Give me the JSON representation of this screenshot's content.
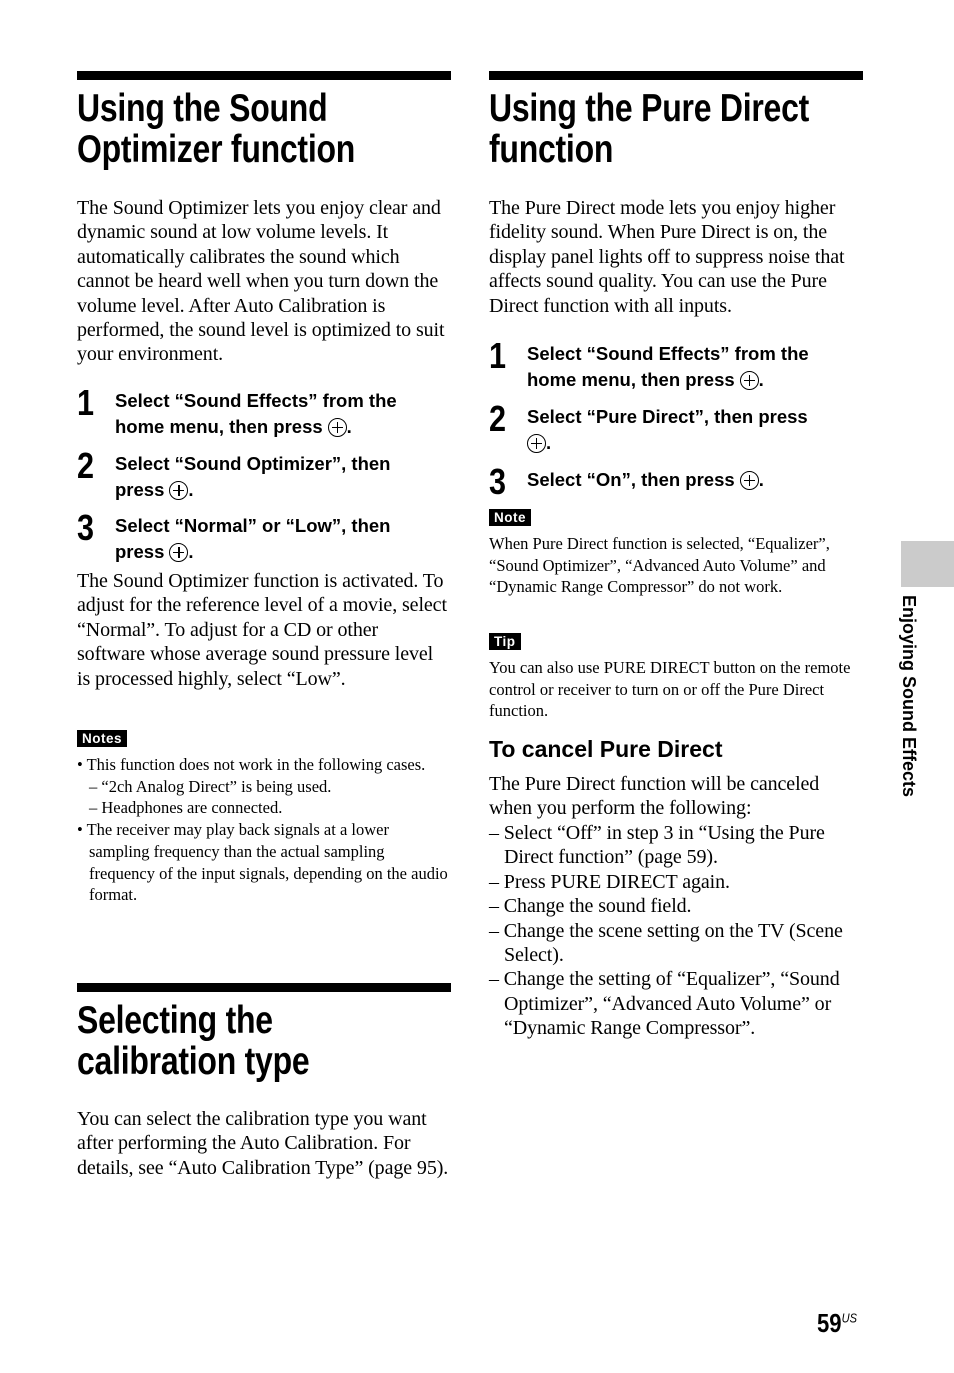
{
  "left": {
    "sound_optimizer": {
      "title_lines": [
        "Using the Sound",
        "Optimizer function"
      ],
      "intro": "The Sound Optimizer lets you enjoy clear and dynamic sound at low volume levels. It automatically calibrates the sound which cannot be heard well when you turn down the volume level. After Auto Calibration is performed, the sound level is optimized to suit your environment.",
      "steps": [
        {
          "num": "1",
          "lines": [
            "Select “Sound Effects” from the",
            "home menu, then press"
          ],
          "end": "."
        },
        {
          "num": "2",
          "lines": [
            "Select “Sound Optimizer”, then",
            "press"
          ],
          "end": "."
        },
        {
          "num": "3",
          "lines": [
            "Select “Normal” or “Low”, then",
            "press"
          ],
          "end": "."
        }
      ],
      "result": "The Sound Optimizer function is activated. To adjust for the reference level of a movie, select “Normal”. To adjust for a CD or other software whose average sound pressure level is processed highly, select “Low”.",
      "notes_label": "Notes",
      "notes": [
        "• This function does not work in the following cases.",
        "– “2ch Analog Direct” is being used.",
        "– Headphones are connected.",
        "• The receiver may play back signals at a lower sampling frequency than the actual sampling frequency of the input signals, depending on the audio format."
      ]
    },
    "calibration": {
      "title_lines": [
        "Selecting the",
        "calibration type"
      ],
      "body": "You can select the calibration type you want after performing the Auto Calibration. For details, see “Auto Calibration Type” (page 95)."
    }
  },
  "right": {
    "title_lines": [
      "Using the Pure Direct",
      "function"
    ],
    "intro": "The Pure Direct mode lets you enjoy higher fidelity sound. When Pure Direct is on, the display panel lights off to suppress noise that affects sound quality. You can use the Pure Direct function with all inputs.",
    "steps": [
      {
        "num": "1",
        "lines": [
          "Select “Sound Effects” from the",
          "home menu, then press"
        ],
        "end": "."
      },
      {
        "num": "2",
        "lines": [
          "Select “Pure Direct”, then press",
          ""
        ],
        "end": "."
      },
      {
        "num": "3",
        "lines": [
          "Select “On”, then press"
        ],
        "end": "."
      }
    ],
    "note_label": "Note",
    "note": "When Pure Direct function is selected, “Equalizer”, “Sound Optimizer”, “Advanced Auto Volume” and “Dynamic Range Compressor” do not work.",
    "tip_label": "Tip",
    "tip": "You can also use PURE DIRECT button on the remote control or receiver to turn on or off the Pure Direct function.",
    "cancel_title": "To cancel Pure Direct",
    "cancel_intro": "The Pure Direct function will be canceled when you perform the following:",
    "cancel_items": [
      "– Select “Off” in step 3 in “Using the Pure Direct function” (page 59).",
      "– Press PURE DIRECT again.",
      "– Change the sound field.",
      "– Change the scene setting on the TV (Scene Select).",
      "– Change the setting of “Equalizer”, “Sound Optimizer”, “Advanced Auto Volume” or “Dynamic Range Compressor”."
    ]
  },
  "side_tab": "Enjoying Sound Effects",
  "page_number": "59",
  "page_suffix": "US",
  "icons": {
    "enter": "enter-button-icon"
  }
}
